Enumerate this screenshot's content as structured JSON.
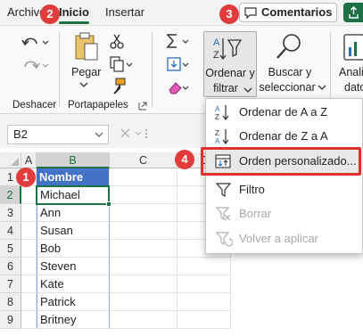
{
  "tabs": {
    "archivo": "Archivo",
    "inicio": "Inicio",
    "insertar": "Insertar"
  },
  "toolbar": {
    "comments_label": "Comentarios"
  },
  "ribbon": {
    "undo_group_label": "Deshacer",
    "clipboard_group_label": "Portapapeles",
    "paste_label": "Pegar",
    "sort_filter_line1": "Ordenar y",
    "sort_filter_line2": "filtrar",
    "find_select_line1": "Buscar y",
    "find_select_line2": "seleccionar",
    "analyze_line1": "Anali",
    "analyze_line2": "dato"
  },
  "formula_bar": {
    "name_box": "B2"
  },
  "grid": {
    "columns": [
      "A",
      "B",
      "C",
      "D"
    ],
    "rows": [
      "1",
      "2",
      "3",
      "4",
      "5",
      "6",
      "7",
      "8",
      "9"
    ],
    "header_cell": "Nombre",
    "names": [
      "Michael",
      "Ann",
      "Susan",
      "Bob",
      "Steven",
      "Kate",
      "Patrick",
      "Britney"
    ]
  },
  "menu": {
    "sort_az": "Ordenar de A a Z",
    "sort_za": "Ordenar de Z a A",
    "custom_sort": "Orden personalizado...",
    "filter": "Filtro",
    "clear": "Borrar",
    "reapply": "Volver a aplicar"
  },
  "badges": [
    "1",
    "2",
    "3",
    "4"
  ],
  "colors": {
    "accent": "#1e7145",
    "header_fill": "#4472c4",
    "badge": "#e23b3b",
    "highlight_border": "#e0312f"
  }
}
